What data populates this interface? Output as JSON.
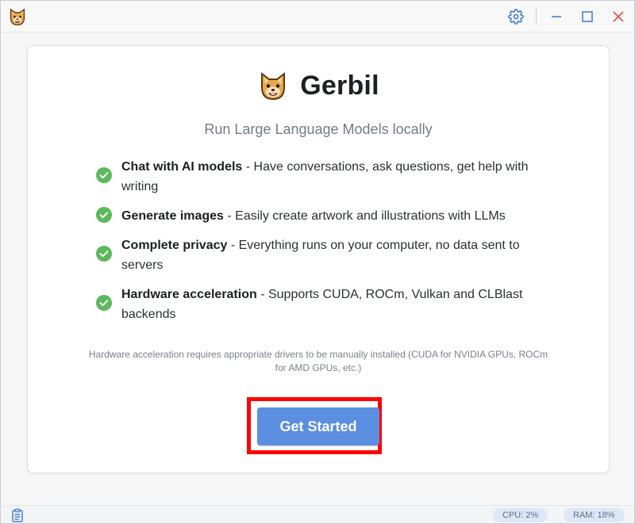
{
  "window": {
    "title": "Gerbil",
    "controls": {
      "settings": "gear-icon",
      "minimize": "minimize-icon",
      "maximize": "maximize-icon",
      "close": "close-icon"
    }
  },
  "main": {
    "app_name": "Gerbil",
    "subtitle": "Run Large Language Models locally",
    "features": [
      {
        "name": "Chat with AI models",
        "desc": " - Have conversations, ask questions, get help with writing"
      },
      {
        "name": "Generate images",
        "desc": " - Easily create artwork and illustrations with LLMs"
      },
      {
        "name": "Complete privacy",
        "desc": " - Everything runs on your computer, no data sent to servers"
      },
      {
        "name": "Hardware acceleration",
        "desc": " - Supports CUDA, ROCm, Vulkan and CLBlast backends"
      }
    ],
    "note": "Hardware acceleration requires appropriate drivers to be manually installed (CUDA for NVIDIA GPUs, ROCm for AMD GPUs, etc.)",
    "cta_label": "Get Started"
  },
  "statusbar": {
    "cpu": "CPU: 2%",
    "ram": "RAM: 18%"
  },
  "colors": {
    "accent": "#5b8ee0",
    "check": "#5cb85c",
    "highlight": "#ff0000",
    "close": "#d9534f"
  }
}
